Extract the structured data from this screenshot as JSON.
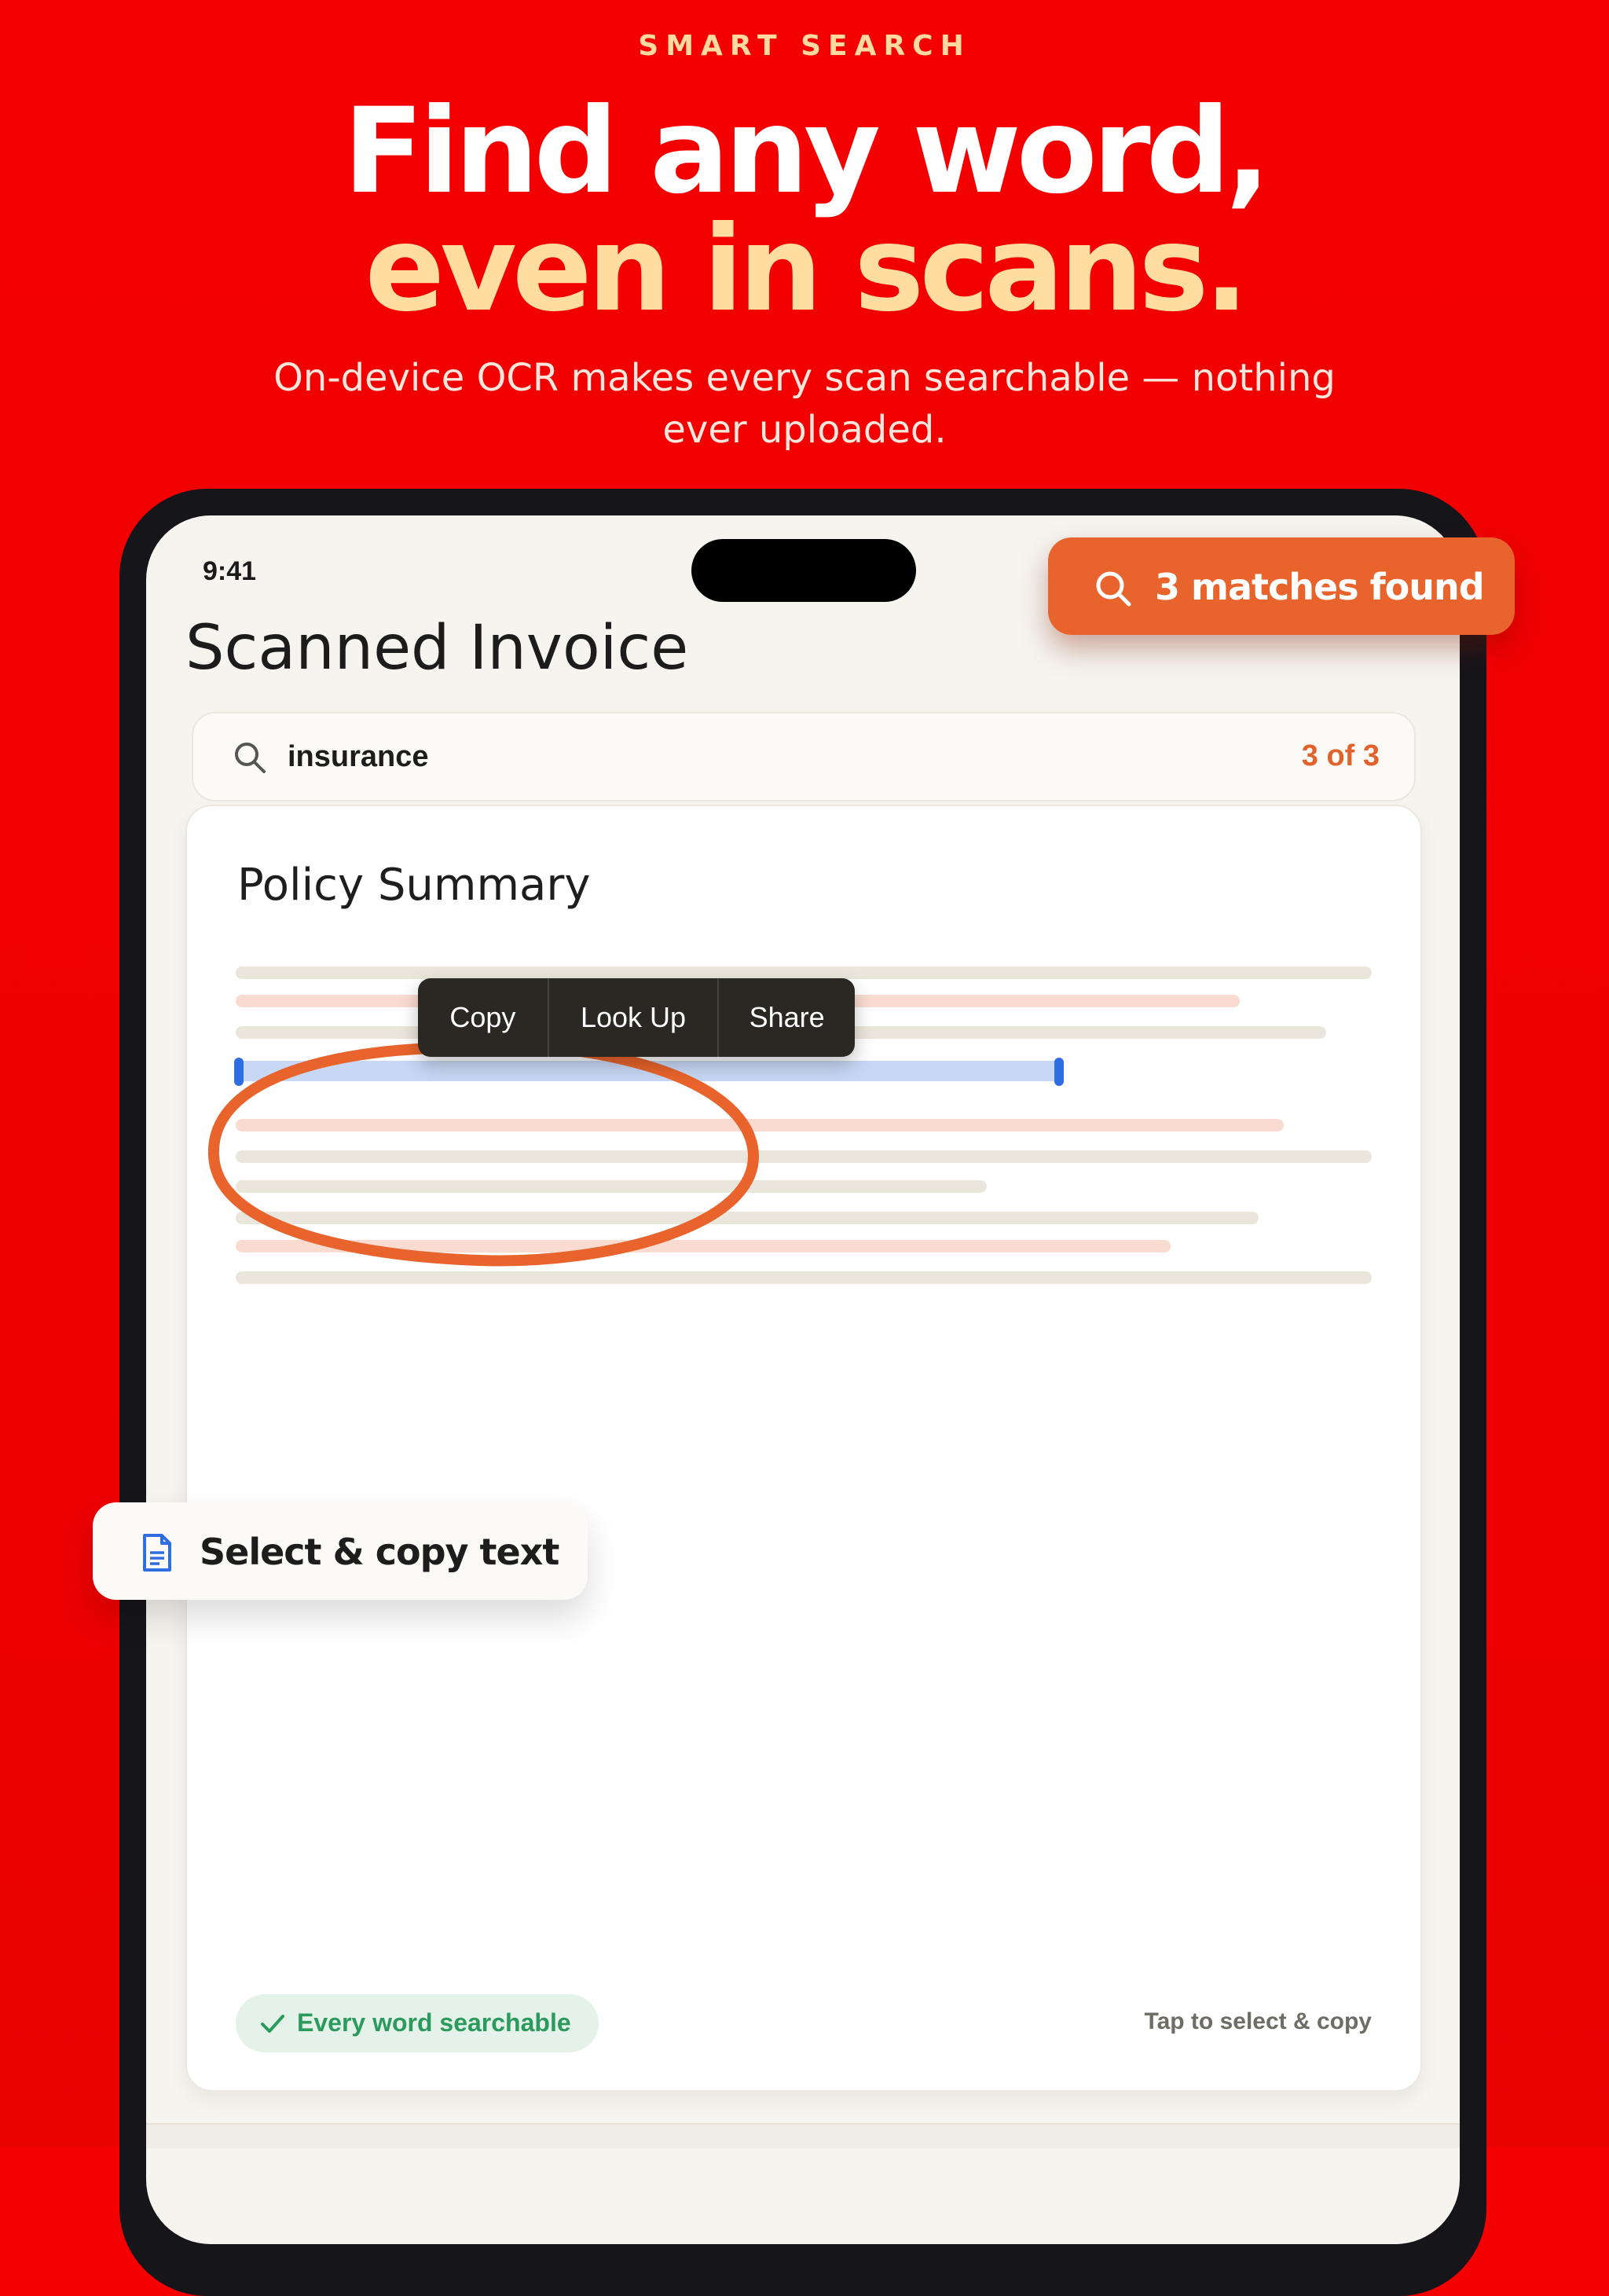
{
  "hero": {
    "eyebrow": "SMART SEARCH",
    "headline_line1": "Find any word,",
    "headline_line2": "even in scans.",
    "subtitle": "On-device OCR makes every scan searchable — nothing ever uploaded."
  },
  "device": {
    "status_time": "9:41",
    "doc_title": "Scanned Invoice",
    "search": {
      "query": "insurance",
      "match_count": "3 of 3",
      "icon": "search-icon"
    },
    "document": {
      "section_title": "Policy Summary"
    },
    "context_menu": {
      "items": [
        "Copy",
        "Look Up",
        "Share"
      ]
    },
    "footer": {
      "pill_label": "Every word searchable",
      "pill_icon": "checkmark-icon",
      "hint": "Tap to select & copy"
    }
  },
  "badges": {
    "matches_label": "3 matches found",
    "matches_icon": "search-icon",
    "copy_label": "Select & copy text",
    "copy_icon": "document-icon"
  },
  "colors": {
    "background": "#f40000",
    "accent_orange": "#e8642c",
    "headline_cream": "#ffdca0",
    "selection_blue": "#2f6ee0",
    "success_green": "#2b9a5c"
  }
}
